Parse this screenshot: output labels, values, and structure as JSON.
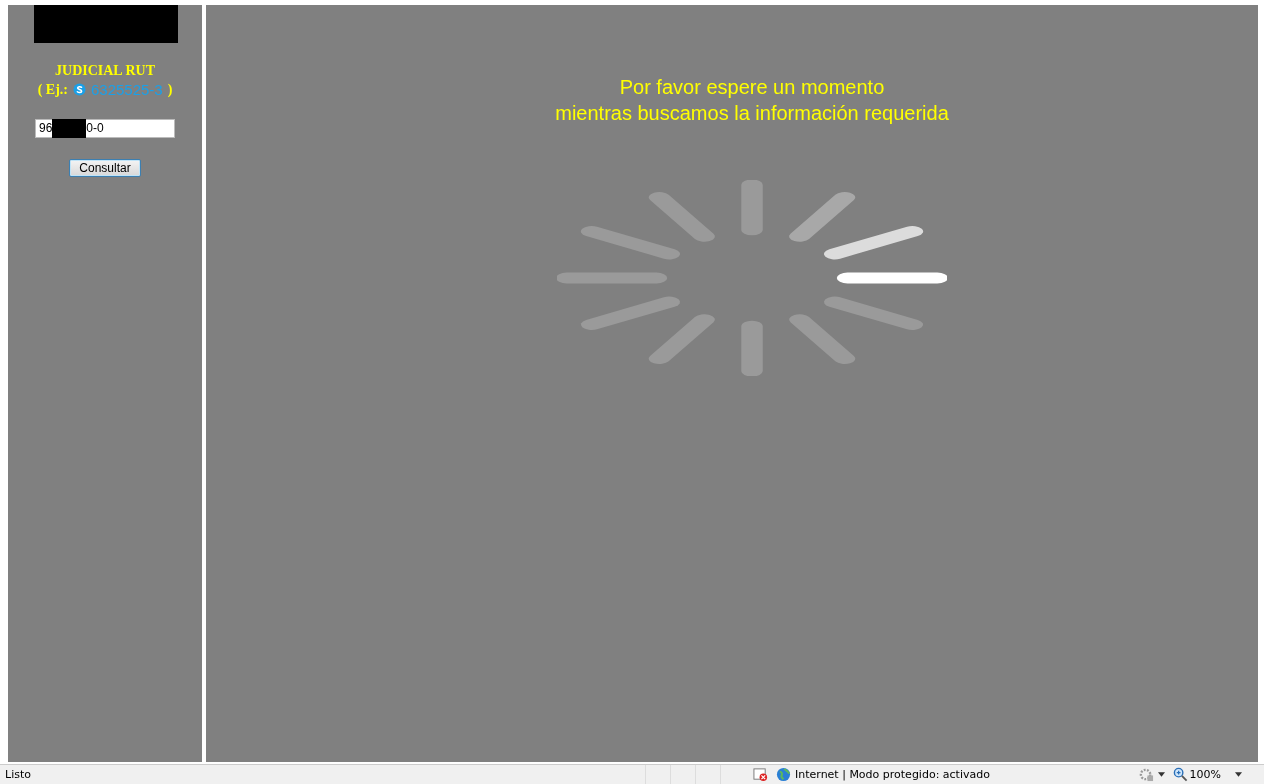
{
  "sidebar": {
    "title": "JUDICIAL RUT",
    "example_prefix": "( Ej.:",
    "example_number": "6325525-3",
    "example_suffix": ")",
    "rut_field": {
      "value_start": "96",
      "value_end": "0-0"
    },
    "button": "Consultar"
  },
  "main": {
    "message_lines": [
      "Por favor espere un momento",
      "mientras buscamos la información requerida"
    ]
  },
  "status_bar": {
    "status": "Listo",
    "zone": "Internet | Modo protegido: activado",
    "zoom": "100%"
  }
}
